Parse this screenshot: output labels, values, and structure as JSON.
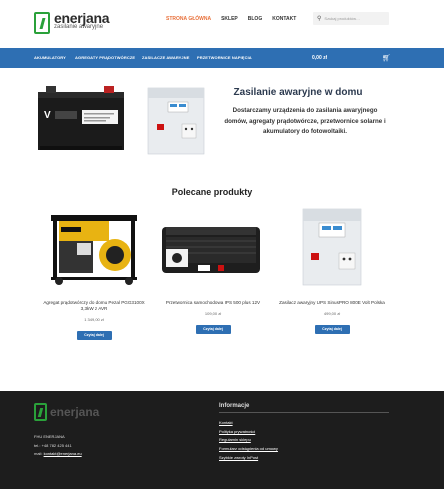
{
  "header": {
    "logo_name": "enerjana",
    "logo_tagline": "zasilanie awaryjne",
    "nav": [
      "STRONA GŁÓWNA",
      "SKLEP",
      "BLOG",
      "KONTAKT"
    ],
    "search_placeholder": "Szukaj produktów…"
  },
  "categories": [
    "AKUMULATORY",
    "AGREGATY PRĄDOTWÓRCZE",
    "ZASILACZE AWARYJNE",
    "PRZETWORNICE NAPIĘCIA"
  ],
  "cart": {
    "total": "0,00 zł"
  },
  "hero": {
    "title": "Zasilanie awaryjne w domu",
    "description": "Dostarczamy urządzenia do zasilania awaryjnego domów, agregaty prądotwórcze, przetwornice solarne i akumulatory do fotowoltaiki."
  },
  "featured_title": "Polecane produkty",
  "products": [
    {
      "name": "Agregat prądotwórczy do domu Pezal PGG3100X 3,3kW z AVR",
      "price": "1 349,00 zł",
      "button": "Czytaj dalej"
    },
    {
      "name": "Przetwornica samochodowa IPS 500 plus 12V",
      "price": "109,00 zł",
      "button": "Czytaj dalej"
    },
    {
      "name": "Zasilacz awaryjny UPS SinusPRO 800E Volt Polska",
      "price": "499,00 zł",
      "button": "Czytaj dalej"
    }
  ],
  "footer": {
    "logo_name": "enerjana",
    "company": "FHU ENERJANA",
    "phone_label": "tel.:",
    "phone": "+48 782 425 441",
    "mail_label": "mail:",
    "email": "kontakt@enerjana.eu",
    "info_title": "Informacje",
    "links": [
      "Kontakt",
      "Polityka prywatności",
      "Regulamin sklepu",
      "Formularz odstąpienia od umowy",
      "Szybkie zwroty InPost"
    ]
  },
  "colors": {
    "accent": "#2e6fb3",
    "nav_active": "#e8703a",
    "footer_bg": "#1d1d1d",
    "logo_green": "#2aa13a"
  }
}
